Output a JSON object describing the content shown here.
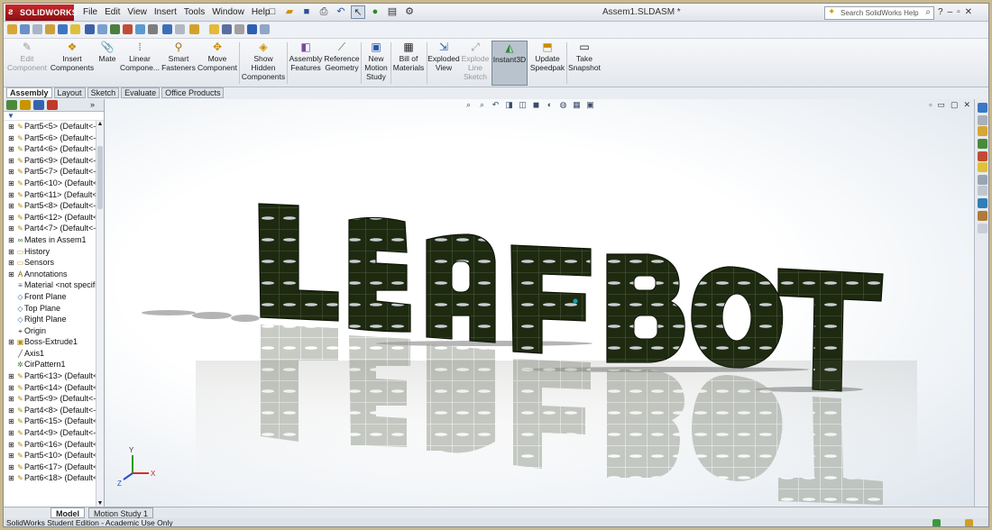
{
  "app": {
    "brand": "SOLIDWORKS",
    "window_title": "Assem1.SLDASM *",
    "menus": [
      "File",
      "Edit",
      "View",
      "Insert",
      "Tools",
      "Window",
      "Help"
    ],
    "search_placeholder": "Search SolidWorks Help"
  },
  "commands": [
    {
      "label": "Edit Component",
      "icon": "edit-component-icon",
      "enabled": false
    },
    {
      "label": "Insert Components",
      "icon": "insert-components-icon",
      "enabled": true
    },
    {
      "label": "Mate",
      "icon": "mate-icon",
      "enabled": true
    },
    {
      "label": "Linear Compone...",
      "icon": "linear-pattern-icon",
      "enabled": true
    },
    {
      "label": "Smart Fasteners",
      "icon": "smart-fasteners-icon",
      "enabled": true
    },
    {
      "label": "Move Component",
      "icon": "move-component-icon",
      "enabled": true
    },
    {
      "label": "Show Hidden Components",
      "icon": "show-hidden-icon",
      "enabled": true
    },
    {
      "label": "Assembly Features",
      "icon": "assembly-features-icon",
      "enabled": true
    },
    {
      "label": "Reference Geometry",
      "icon": "reference-geometry-icon",
      "enabled": true
    },
    {
      "label": "New Motion Study",
      "icon": "new-motion-study-icon",
      "enabled": true
    },
    {
      "label": "Bill of Materials",
      "icon": "bill-of-materials-icon",
      "enabled": true
    },
    {
      "label": "Exploded View",
      "icon": "exploded-view-icon",
      "enabled": true
    },
    {
      "label": "Explode Line Sketch",
      "icon": "explode-line-sketch-icon",
      "enabled": false
    },
    {
      "label": "Instant3D",
      "icon": "instant3d-icon",
      "enabled": true,
      "active": true
    },
    {
      "label": "Update Speedpak",
      "icon": "update-speedpak-icon",
      "enabled": true
    },
    {
      "label": "Take Snapshot",
      "icon": "take-snapshot-icon",
      "enabled": true
    }
  ],
  "cm_tabs": [
    "Assembly",
    "Layout",
    "Sketch",
    "Evaluate",
    "Office Products"
  ],
  "active_cm_tab": "Assembly",
  "tree": [
    {
      "label": "Part5<5> (Default<-",
      "icon": "part-icon"
    },
    {
      "label": "Part5<6> (Default<-",
      "icon": "part-icon"
    },
    {
      "label": "Part4<6> (Default<-",
      "icon": "part-icon"
    },
    {
      "label": "Part6<9> (Default<-",
      "icon": "part-icon"
    },
    {
      "label": "Part5<7> (Default<-",
      "icon": "part-icon"
    },
    {
      "label": "Part6<10> (Default<",
      "icon": "part-icon"
    },
    {
      "label": "Part6<11> (Default<",
      "icon": "part-icon"
    },
    {
      "label": "Part5<8> (Default<-",
      "icon": "part-icon"
    },
    {
      "label": "Part6<12> (Default<",
      "icon": "part-icon"
    },
    {
      "label": "Part4<7> (Default<-",
      "icon": "part-icon"
    },
    {
      "label": "Mates in Assem1",
      "icon": "mates-icon"
    },
    {
      "label": "History",
      "icon": "folder-icon"
    },
    {
      "label": "Sensors",
      "icon": "folder-icon"
    },
    {
      "label": "Annotations",
      "icon": "annotations-icon"
    },
    {
      "label": "Material <not specifi",
      "icon": "material-icon"
    },
    {
      "label": "Front Plane",
      "icon": "plane-icon"
    },
    {
      "label": "Top Plane",
      "icon": "plane-icon"
    },
    {
      "label": "Right Plane",
      "icon": "plane-icon"
    },
    {
      "label": "Origin",
      "icon": "origin-icon"
    },
    {
      "label": "Boss-Extrude1",
      "icon": "extrude-icon"
    },
    {
      "label": "Axis1",
      "icon": "axis-icon"
    },
    {
      "label": "CirPattern1",
      "icon": "pattern-icon"
    },
    {
      "label": "Part6<13> (Default<",
      "icon": "part-icon"
    },
    {
      "label": "Part6<14> (Default<",
      "icon": "part-icon"
    },
    {
      "label": "Part5<9> (Default<-",
      "icon": "part-icon"
    },
    {
      "label": "Part4<8> (Default<-",
      "icon": "part-icon"
    },
    {
      "label": "Part6<15> (Default<",
      "icon": "part-icon"
    },
    {
      "label": "Part4<9> (Default<-",
      "icon": "part-icon"
    },
    {
      "label": "Part6<16> (Default<",
      "icon": "part-icon"
    },
    {
      "label": "Part5<10> (Default<",
      "icon": "part-icon"
    },
    {
      "label": "Part6<17> (Default<",
      "icon": "part-icon"
    },
    {
      "label": "Part6<18> (Default<",
      "icon": "part-icon"
    }
  ],
  "model": {
    "text": "LEAFBOT",
    "color": "#1e2a10"
  },
  "triad": {
    "x": "X",
    "y": "Y",
    "z": "Z"
  },
  "bottom_tabs": [
    "Model",
    "Motion Study 1"
  ],
  "status_text": "SolidWorks Student Edition - Academic Use Only"
}
